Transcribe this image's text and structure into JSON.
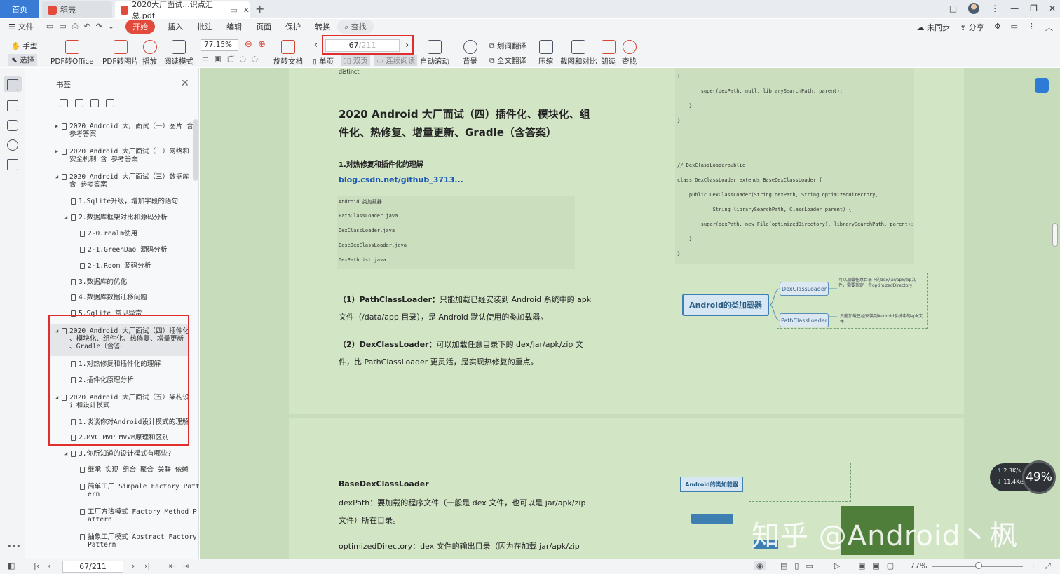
{
  "tabs": {
    "home": "首页",
    "daoke": "稻壳",
    "pdf": "2020大厂面试...识点汇总.pdf"
  },
  "menu": {
    "file": "文件",
    "items": [
      "开始",
      "插入",
      "批注",
      "编辑",
      "页面",
      "保护",
      "转换"
    ],
    "search": "查找",
    "right": [
      "未同步",
      "分享"
    ]
  },
  "ribbon": {
    "hand": "手型",
    "select": "选择",
    "pdf_office": "PDF转Office",
    "pdf_image": "PDF转图片",
    "play": "播放",
    "read_mode": "阅读模式",
    "zoom": "77.15%",
    "rotate": "旋转文档",
    "single": "单页",
    "double": "双页",
    "continuous": "连续阅读",
    "auto_scroll": "自动滚动",
    "background": "背景",
    "word_translate": "划词翻译",
    "full_translate": "全文翻译",
    "compress": "压缩",
    "screenshot_compare": "截图和对比",
    "read_aloud": "朗读",
    "find": "查找",
    "page_current": "67",
    "page_total": "/211"
  },
  "bookmarks": {
    "title": "书签",
    "items": [
      {
        "text": "2020 Android 大厂面试（一）图片 含\n参考答案",
        "arrow": "▶"
      },
      {
        "text": "2020 Android 大厂面试（二）网络和\n安全机制 含 参考答案",
        "arrow": "▶"
      },
      {
        "text": "2020 Android 大厂面试（三）数据库\n含 参考答案",
        "arrow": "◢"
      },
      {
        "text": "1.Sqlite升级，增加字段的语句",
        "arrow": ""
      },
      {
        "text": "2.数据库框架对比和源码分析",
        "arrow": "◢"
      },
      {
        "text": "2-0.realm使用",
        "arrow": ""
      },
      {
        "text": "2-1.GreenDao 源码分析",
        "arrow": ""
      },
      {
        "text": "2-1.Room 源码分析",
        "arrow": ""
      },
      {
        "text": "3.数据库的优化",
        "arrow": ""
      },
      {
        "text": "4.数据库数据迁移问题",
        "arrow": ""
      },
      {
        "text": "5.Sqlite 常见异常",
        "arrow": ""
      },
      {
        "text": "2020 Android 大厂面试（四）插件化\n、模块化、组件化、热修复、增量更新\n、Gradle（含答",
        "arrow": "◢"
      },
      {
        "text": "1.对热修复和插件化的理解",
        "arrow": ""
      },
      {
        "text": "2.插件化原理分析",
        "arrow": ""
      },
      {
        "text": "2020 Android 大厂面试（五）架构设\n计和设计模式",
        "arrow": "◢"
      },
      {
        "text": "1.谈谈你对Android设计模式的理解",
        "arrow": ""
      },
      {
        "text": "2.MVC MVP MVVM原理和区别",
        "arrow": ""
      },
      {
        "text": "3.你所知道的设计模式有哪些?",
        "arrow": "◢"
      },
      {
        "text": "继承 实现 组合 聚合 关联 依赖",
        "arrow": ""
      },
      {
        "text": "简单工厂 Simpale Factory Patt\nern",
        "arrow": ""
      },
      {
        "text": "工厂方法模式 Factory Method P\nattern",
        "arrow": ""
      },
      {
        "text": "抽象工厂模式 Abstract Factory\nPattern",
        "arrow": ""
      }
    ]
  },
  "doc": {
    "distinct": "distinct",
    "heading_line1": "2020 Android 大厂面试（四）插件化、模块化、组",
    "heading_line2": "件化、热修复、增量更新、Gradle（含答案）",
    "sub1": "1.对热修复和插件化的理解",
    "link": "blog.csdn.net/github_3713...",
    "code_left": [
      "Android 类加载器",
      "PathClassLoader.java",
      "DexClassLoader.java",
      "BaseDexClassLoader.java",
      "DexPathList.java"
    ],
    "para1_bold": "（1）PathClassLoader：",
    "para1_a": "只能加载已经安装到 Android 系统中的 apk",
    "para1_b": "文件（/data/app 目录），是 Android 默认使用的类加载器。",
    "para2_bold": "（2）DexClassLoader：",
    "para2_a": "可以加载任意目录下的 dex/jar/apk/zip 文",
    "para2_b": "件，比 PathClassLoader 更灵活，是实现热修复的重点。",
    "code_right": [
      "{",
      "        super(dexPath, null, librarySearchPath, parent);",
      "    }",
      "}",
      "// DexClassLoaderpublic",
      "class DexClassLoader extends BaseDexClassLoader {",
      "    public DexClassLoader(String dexPath, String optimizedDirectory,",
      "            String librarySearchPath, ClassLoader parent) {",
      "        super(dexPath, new File(optimizedDirectory), librarySearchPath, parent);",
      "    }",
      "}"
    ],
    "mm_main": "Android的类加载器",
    "mm_dex": "DexClassLoader",
    "mm_path": "PathClassLoader",
    "mm_dex_note": "可以加载任意目录下的dex/jar/apk/zip文件，需要指定一个optimizedDirectory",
    "mm_path_note": "只能加载已经安装到Android系统中的apk文件",
    "base_title": "BaseDexClassLoader",
    "base_p1": "dexPath：要加载的程序文件（一般是 dex 文件，也可以是 jar/apk/zip",
    "base_p2": "文件）所在目录。",
    "base_p3": "optimizedDirectory：dex 文件的输出目录（因为在加载 jar/apk/zip"
  },
  "floater": {
    "up": "2.3K/s",
    "down": "11.4K/s",
    "percent": "49%"
  },
  "watermark": "知乎 @Android丶枫",
  "status": {
    "page": "67/211",
    "zoom": "77%"
  }
}
